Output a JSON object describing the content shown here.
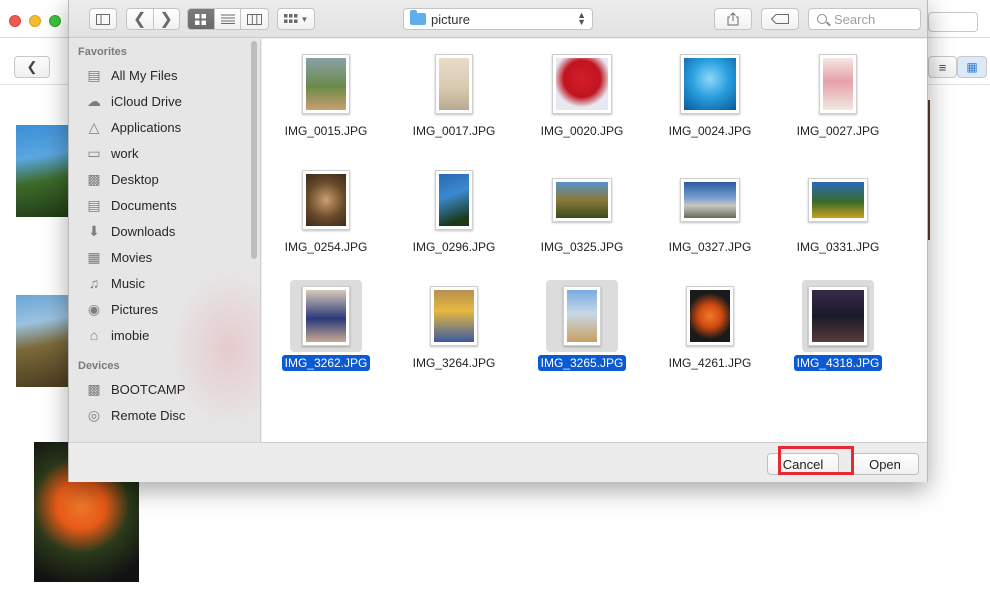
{
  "toolbar": {
    "location": "picture",
    "search_placeholder": "Search"
  },
  "sidebar": {
    "favorites_header": "Favorites",
    "favorites": [
      {
        "label": "All My Files",
        "icon": "all-files-icon"
      },
      {
        "label": "iCloud Drive",
        "icon": "cloud-icon"
      },
      {
        "label": "Applications",
        "icon": "applications-icon"
      },
      {
        "label": "work",
        "icon": "folder-icon"
      },
      {
        "label": "Desktop",
        "icon": "desktop-icon"
      },
      {
        "label": "Documents",
        "icon": "documents-icon"
      },
      {
        "label": "Downloads",
        "icon": "downloads-icon"
      },
      {
        "label": "Movies",
        "icon": "movies-icon"
      },
      {
        "label": "Music",
        "icon": "music-icon"
      },
      {
        "label": "Pictures",
        "icon": "camera-icon"
      },
      {
        "label": "imobie",
        "icon": "home-icon"
      }
    ],
    "devices_header": "Devices",
    "devices": [
      {
        "label": "BOOTCAMP",
        "icon": "disk-icon"
      },
      {
        "label": "Remote Disc",
        "icon": "disc-icon"
      }
    ]
  },
  "files": [
    {
      "name": "IMG_0015.JPG",
      "selected": false
    },
    {
      "name": "IMG_0017.JPG",
      "selected": false
    },
    {
      "name": "IMG_0020.JPG",
      "selected": false
    },
    {
      "name": "IMG_0024.JPG",
      "selected": false
    },
    {
      "name": "IMG_0027.JPG",
      "selected": false
    },
    {
      "name": "IMG_0254.JPG",
      "selected": false
    },
    {
      "name": "IMG_0296.JPG",
      "selected": false
    },
    {
      "name": "IMG_0325.JPG",
      "selected": false
    },
    {
      "name": "IMG_0327.JPG",
      "selected": false
    },
    {
      "name": "IMG_0331.JPG",
      "selected": false
    },
    {
      "name": "IMG_3262.JPG",
      "selected": true
    },
    {
      "name": "IMG_3264.JPG",
      "selected": false
    },
    {
      "name": "IMG_3265.JPG",
      "selected": true
    },
    {
      "name": "IMG_4261.JPG",
      "selected": false
    },
    {
      "name": "IMG_4318.JPG",
      "selected": true
    }
  ],
  "buttons": {
    "cancel": "Cancel",
    "open": "Open"
  },
  "colors": {
    "selection": "#0a5ad2",
    "highlight_box": "#e8292f"
  }
}
